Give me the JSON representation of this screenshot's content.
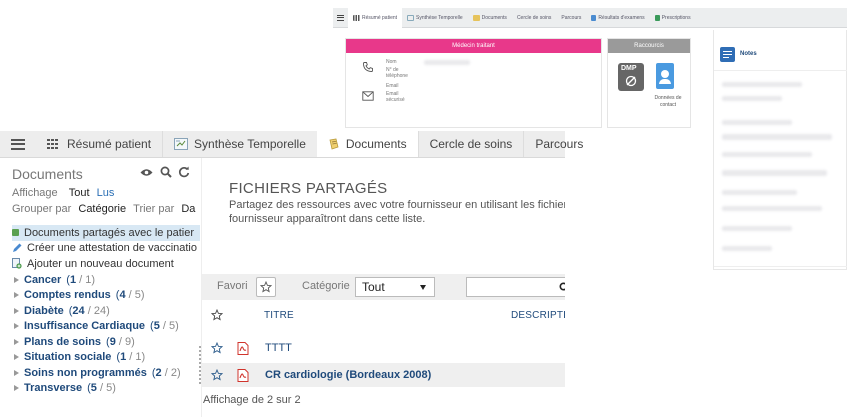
{
  "background_window": {
    "tabs": [
      {
        "label": "Résumé patient",
        "icon": "grid-icon",
        "active": true
      },
      {
        "label": "Synthèse Temporelle",
        "icon": "timeline-icon"
      },
      {
        "label": "Documents",
        "icon": "document-icon"
      },
      {
        "label": "Cercle de soins"
      },
      {
        "label": "Parcours"
      },
      {
        "label": "Résultats d'examens",
        "icon": "chart-icon"
      },
      {
        "label": "Prescriptions",
        "icon": "pill-icon"
      }
    ],
    "medecin_card": {
      "title": "Médecin traitant",
      "fields": {
        "nom": "Nom",
        "telephone_1": "N° de",
        "telephone_2": "téléphone",
        "email": "Email",
        "email_secure_1": "Email",
        "email_secure_2": "sécurisé"
      }
    },
    "raccourcis_card": {
      "title": "Raccourcis",
      "dmp_label": "DMP",
      "contact_1": "Données de",
      "contact_2": "contact"
    },
    "notes_panel": {
      "title": "Notes"
    }
  },
  "tabs": [
    {
      "label": "",
      "icon": "menu-icon"
    },
    {
      "label": "Résumé patient",
      "icon": "grid-icon"
    },
    {
      "label": "Synthèse Temporelle",
      "icon": "timeline-icon"
    },
    {
      "label": "Documents",
      "icon": "document-icon",
      "active": true
    },
    {
      "label": "Cercle de soins"
    },
    {
      "label": "Parcours"
    }
  ],
  "sidebar": {
    "title": "Documents",
    "affichage_label": "Affichage",
    "affichage_tout": "Tout",
    "affichage_lus": "Lus",
    "grouper_label": "Grouper par",
    "grouper_value": "Catégorie",
    "trier_label": "Trier par",
    "trier_value": "Da",
    "actions": [
      {
        "label": "Documents partagés avec le patier",
        "icon": "shared-doc-icon"
      },
      {
        "label": "Créer une attestation de vaccinatio",
        "icon": "pen-icon"
      },
      {
        "label": "Ajouter un nouveau document",
        "icon": "add-document-icon"
      }
    ],
    "categories": [
      {
        "name": "Cancer",
        "unread": "1",
        "total": "1"
      },
      {
        "name": "Comptes rendus",
        "unread": "4",
        "total": "5"
      },
      {
        "name": "Diabète",
        "unread": "24",
        "total": "24"
      },
      {
        "name": "Insuffisance Cardiaque",
        "unread": "5",
        "total": "5"
      },
      {
        "name": "Plans de soins",
        "unread": "9",
        "total": "9"
      },
      {
        "name": "Situation sociale",
        "unread": "1",
        "total": "1"
      },
      {
        "name": "Soins non programmés",
        "unread": "2",
        "total": "2"
      },
      {
        "name": "Transverse",
        "unread": "5",
        "total": "5"
      }
    ]
  },
  "main": {
    "title": "FICHIERS PARTAGÉS",
    "description_line1": "Partagez des ressources avec votre fournisseur en utilisant les fichier",
    "description_line2": "fournisseur apparaîtront dans cette liste.",
    "filter": {
      "favori_label": "Favori",
      "categorie_label": "Catégorie",
      "categorie_value": "Tout",
      "search_placeholder": ""
    },
    "table": {
      "columns": [
        "TITRE",
        "DESCRIPTIO"
      ],
      "rows": [
        {
          "title": "TTTT",
          "bold": false
        },
        {
          "title": "CR cardiologie (Bordeaux 2008)",
          "bold": true
        }
      ]
    },
    "footer": "Affichage de 2 sur 2"
  },
  "colors": {
    "medecin_header": "#e8388a",
    "raccourcis_header": "#9a9a9a",
    "link": "#1f4a7b",
    "pdf_icon": "#d0342c",
    "notes_icon": "#2f6db5"
  }
}
